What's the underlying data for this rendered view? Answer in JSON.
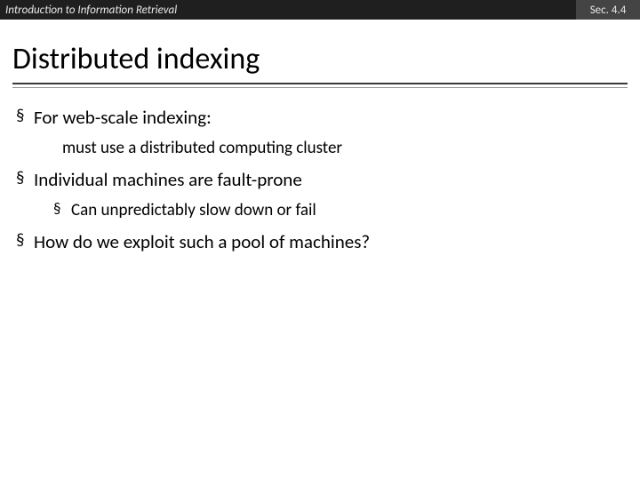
{
  "header": {
    "course": "Introduction to Information Retrieval",
    "section": "Sec. 4.4"
  },
  "title": "Distributed indexing",
  "bullets": {
    "b1": "For web-scale indexing:",
    "b1a": "must use a distributed computing cluster",
    "b2": "Individual machines are fault-prone",
    "b2a": "Can unpredictably slow down or fail",
    "b3": "How do we exploit such a pool of machines?"
  }
}
